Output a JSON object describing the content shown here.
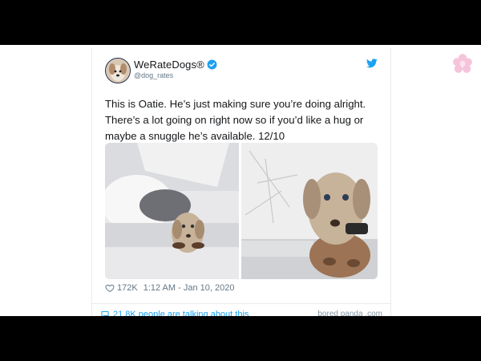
{
  "tweet": {
    "display_name": "WeRateDogs®",
    "handle": "@dog_rates",
    "text": "This is Oatie. He’s just making sure you’re doing alright. There’s a lot going on right now so if you’d like a hug or maybe a snuggle he’s available. 12/10",
    "likes": "172K",
    "timestamp": "1:12 AM - Jan 10, 2020",
    "footer_people": "21.8K people are talking about this",
    "footer_right": "bored panda .com"
  },
  "icons": {
    "verified": "verified-badge-icon",
    "twitter": "twitter-bird-icon",
    "like": "heart-icon",
    "comment": "speech-bubble-icon"
  },
  "colors": {
    "twitter_blue": "#1da1f2",
    "text": "#14171a",
    "muted": "#657786",
    "letterbox": "#000000"
  }
}
